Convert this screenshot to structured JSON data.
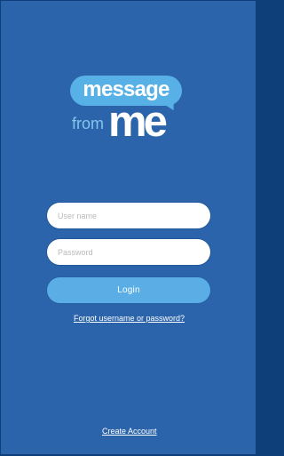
{
  "app": {
    "logo": {
      "line1": "message",
      "line2_small": "from",
      "line2_big": "me"
    }
  },
  "login_form": {
    "username_placeholder": "User name",
    "password_placeholder": "Password",
    "login_label": "Login",
    "forgot_link": "Forgot username or password?"
  },
  "footer": {
    "create_account": "Create Account"
  },
  "colors": {
    "background": "#2b64aa",
    "logo_bubble": "#57b0e6",
    "button": "#5aaee5",
    "input_background": "#ffffff",
    "text": "#ffffff"
  }
}
